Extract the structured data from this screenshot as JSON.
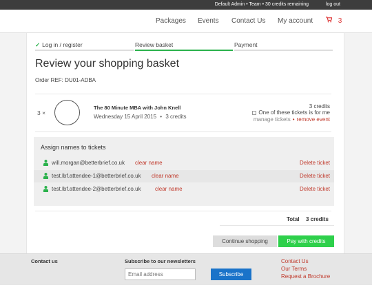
{
  "topbar": {
    "status": "Default Admin • Team • 30 credits remaining",
    "logout": "log out"
  },
  "nav": {
    "items": [
      "Packages",
      "Events",
      "Contact Us",
      "My account"
    ],
    "cart_icon": "cart-icon",
    "cart_count": "3",
    "accent": "#d33333"
  },
  "steps": [
    {
      "label": "Log in / register",
      "state": "done"
    },
    {
      "label": "Review basket",
      "state": "active"
    },
    {
      "label": "Payment",
      "state": "pending"
    }
  ],
  "page": {
    "title": "Review your shopping basket",
    "order_ref": "Order REF: DU01-ADBA"
  },
  "event": {
    "qty": "3 ×",
    "title": "The 80 Minute MBA with John Knell",
    "date": "Wednesday 15 April 2015",
    "dot": "•",
    "credits_small": "3 credits",
    "credits": "3 credits",
    "mine_label": "One of these tickets is for me",
    "manage": "manage tickets",
    "link_dot": "•",
    "remove": "remove event"
  },
  "assign": {
    "heading": "Assign names to tickets",
    "attendees": [
      {
        "email": "will.morgan@betterbrief.co.uk",
        "clear": "clear name",
        "delete": "Delete ticket"
      },
      {
        "email": "test.lbf.attendee-1@betterbrief.co.uk",
        "clear": "clear name",
        "delete": "Delete ticket"
      },
      {
        "email": "test.lbf.attendee-2@betterbrief.co.uk",
        "clear": "clear name",
        "delete": "Delete ticket"
      }
    ]
  },
  "totals": {
    "label": "Total",
    "value": "3 credits"
  },
  "buttons": {
    "continue": "Continue shopping",
    "pay": "Pay with credits"
  },
  "footer": {
    "contact_heading": "Contact us",
    "newsletter_heading": "Subscribe to our newsletters",
    "email_placeholder": "Email address",
    "subscribe": "Subscribe",
    "links": [
      "Contact Us",
      "Our Terms",
      "Request a Brochure"
    ]
  },
  "colors": {
    "green": "#2bb24c",
    "red": "#c0392b",
    "blue": "#1a73c9"
  }
}
